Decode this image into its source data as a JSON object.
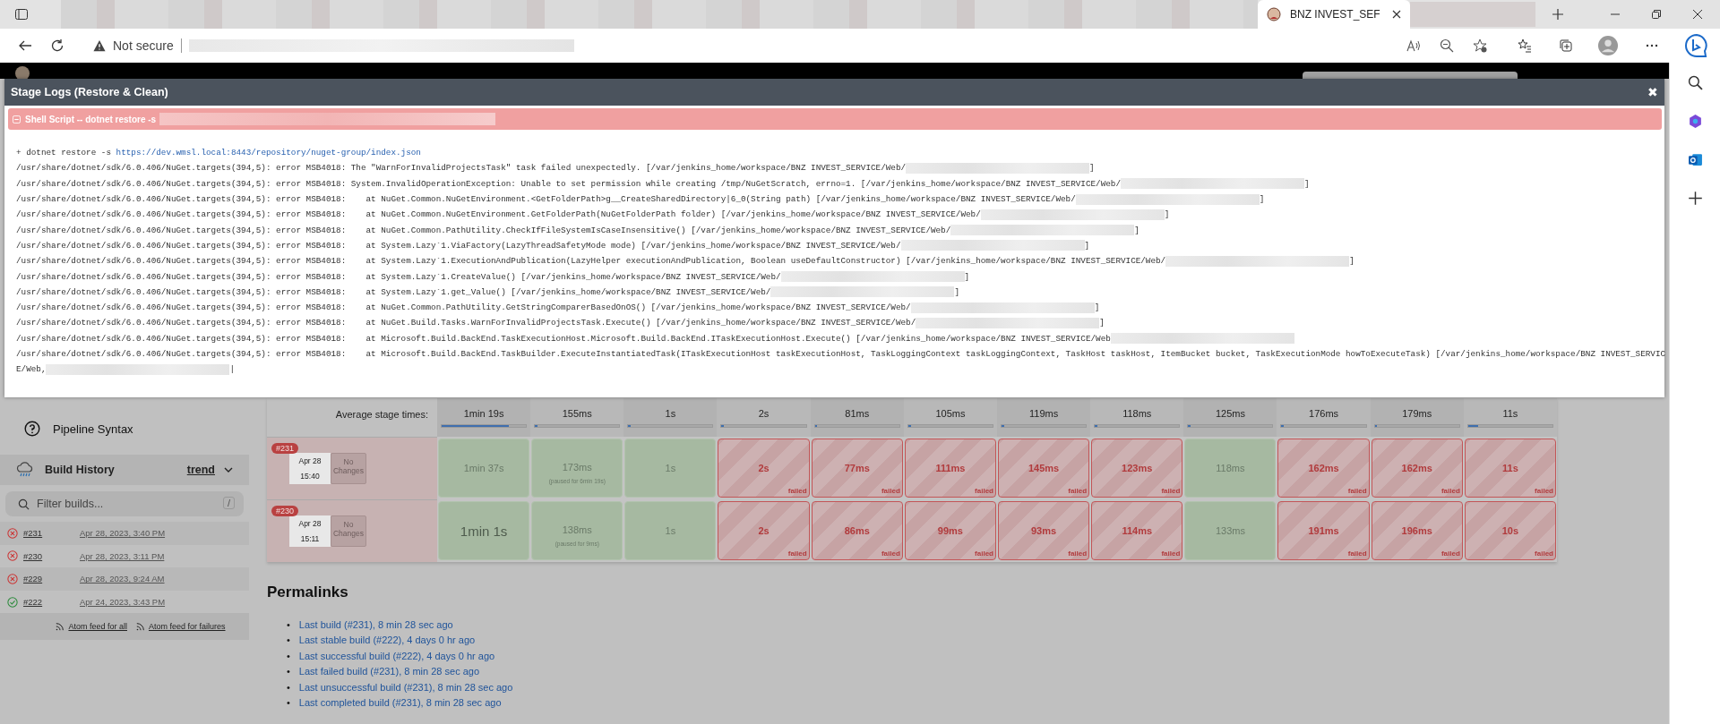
{
  "browser": {
    "tab_title": "BNZ INVEST_SEF",
    "security_label": "Not secure"
  },
  "modal": {
    "title": "Stage Logs (Restore & Clean)",
    "close": "✖",
    "step": {
      "title": "Shell Script -- dotnet restore -s",
      "expanded": true,
      "redacted": true
    },
    "log_lines": [
      {
        "kind": "command",
        "text": "+ dotnet restore -s ",
        "link": "https://dev.wmsl.local:8443/repository/nuget-group/index.json",
        "redacted": false
      },
      {
        "kind": "output",
        "text": "/usr/share/dotnet/sdk/6.0.406/NuGet.targets(394,5): error MSB4018: The \"WarnForInvalidProjectsTask\" task failed unexpectedly. [/var/jenkins_home/workspace/BNZ INVEST_SERVICE/Web/",
        "redacted": true,
        "suffix": "]"
      },
      {
        "kind": "output",
        "text": "/usr/share/dotnet/sdk/6.0.406/NuGet.targets(394,5): error MSB4018: System.InvalidOperationException: Unable to set permission while creating /tmp/NuGetScratch, errno=1. [/var/jenkins_home/workspace/BNZ INVEST_SERVICE/Web/",
        "redacted": true,
        "suffix": "]"
      },
      {
        "kind": "output",
        "text": "/usr/share/dotnet/sdk/6.0.406/NuGet.targets(394,5): error MSB4018:    at NuGet.Common.NuGetEnvironment.<GetFolderPath>g__CreateSharedDirectory|6_0(String path) [/var/jenkins_home/workspace/BNZ INVEST_SERVICE/Web/",
        "redacted": true,
        "suffix": "]"
      },
      {
        "kind": "output",
        "text": "/usr/share/dotnet/sdk/6.0.406/NuGet.targets(394,5): error MSB4018:    at NuGet.Common.NuGetEnvironment.GetFolderPath(NuGetFolderPath folder) [/var/jenkins_home/workspace/BNZ INVEST_SERVICE/Web/",
        "redacted": true,
        "suffix": "]"
      },
      {
        "kind": "output",
        "text": "/usr/share/dotnet/sdk/6.0.406/NuGet.targets(394,5): error MSB4018:    at NuGet.Common.PathUtility.CheckIfFileSystemIsCaseInsensitive() [/var/jenkins_home/workspace/BNZ INVEST_SERVICE/Web/",
        "redacted": true,
        "suffix": "]"
      },
      {
        "kind": "output",
        "text": "/usr/share/dotnet/sdk/6.0.406/NuGet.targets(394,5): error MSB4018:    at System.Lazy`1.ViaFactory(LazyThreadSafetyMode mode) [/var/jenkins_home/workspace/BNZ INVEST_SERVICE/Web/",
        "redacted": true,
        "suffix": "]"
      },
      {
        "kind": "output",
        "text": "/usr/share/dotnet/sdk/6.0.406/NuGet.targets(394,5): error MSB4018:    at System.Lazy`1.ExecutionAndPublication(LazyHelper executionAndPublication, Boolean useDefaultConstructor) [/var/jenkins_home/workspace/BNZ INVEST_SERVICE/Web/",
        "redacted": true,
        "suffix": "]"
      },
      {
        "kind": "output",
        "text": "/usr/share/dotnet/sdk/6.0.406/NuGet.targets(394,5): error MSB4018:    at System.Lazy`1.CreateValue() [/var/jenkins_home/workspace/BNZ INVEST_SERVICE/Web/",
        "redacted": true,
        "suffix": "]"
      },
      {
        "kind": "output",
        "text": "/usr/share/dotnet/sdk/6.0.406/NuGet.targets(394,5): error MSB4018:    at System.Lazy`1.get_Value() [/var/jenkins_home/workspace/BNZ INVEST_SERVICE/Web/",
        "redacted": true,
        "suffix": "]"
      },
      {
        "kind": "output",
        "text": "/usr/share/dotnet/sdk/6.0.406/NuGet.targets(394,5): error MSB4018:    at NuGet.Common.PathUtility.GetStringComparerBasedOnOS() [/var/jenkins_home/workspace/BNZ INVEST_SERVICE/Web/",
        "redacted": true,
        "suffix": "]"
      },
      {
        "kind": "output",
        "text": "/usr/share/dotnet/sdk/6.0.406/NuGet.targets(394,5): error MSB4018:    at NuGet.Build.Tasks.WarnForInvalidProjectsTask.Execute() [/var/jenkins_home/workspace/BNZ INVEST_SERVICE/Web/",
        "redacted": true,
        "suffix": "]"
      },
      {
        "kind": "output",
        "text": "/usr/share/dotnet/sdk/6.0.406/NuGet.targets(394,5): error MSB4018:    at Microsoft.Build.BackEnd.TaskExecutionHost.Microsoft.Build.BackEnd.ITaskExecutionHost.Execute() [/var/jenkins_home/workspace/BNZ INVEST_SERVICE/Web",
        "redacted": true
      },
      {
        "kind": "output",
        "text": "/usr/share/dotnet/sdk/6.0.406/NuGet.targets(394,5): error MSB4018:    at Microsoft.Build.BackEnd.TaskBuilder.ExecuteInstantiatedTask(ITaskExecutionHost taskExecutionHost, TaskLoggingContext taskLoggingContext, TaskHost taskHost, ItemBucket bucket, TaskExecutionMode howToExecuteTask) [/var/jenkins_home/workspace/BNZ INVEST_SERVIC",
        "redacted": false
      },
      {
        "kind": "output",
        "text": "E/Web,",
        "redacted": true,
        "suffix": "|"
      }
    ]
  },
  "sidebar": {
    "items": [
      {
        "label": "Pipeline Syntax"
      }
    ],
    "build_history": {
      "title": "Build History",
      "trend": "trend",
      "filter": {
        "placeholder": "Filter builds...",
        "shortcut": "/"
      },
      "builds": [
        {
          "kind": "failed",
          "number": "#231",
          "date": "Apr 28, 2023, 3:40 PM"
        },
        {
          "kind": "failed",
          "number": "#230",
          "date": "Apr 28, 2023, 3:11 PM"
        },
        {
          "kind": "failed",
          "number": "#229",
          "date": "Apr 28, 2023, 9:24 AM"
        },
        {
          "kind": "success",
          "number": "#222",
          "date": "Apr 24, 2023, 3:43 PM"
        }
      ],
      "feeds": [
        "Atom feed for all",
        "Atom feed for failures"
      ]
    }
  },
  "stage_view": {
    "average_label": "Average stage times:",
    "averages": [
      {
        "time": "1min 19s",
        "level": 0.8
      },
      {
        "time": "155ms",
        "level": 0.03
      },
      {
        "time": "1s",
        "level": 0.03
      },
      {
        "time": "2s",
        "level": 0.03
      },
      {
        "time": "81ms",
        "level": 0.03
      },
      {
        "time": "105ms",
        "level": 0.03
      },
      {
        "time": "119ms",
        "level": 0.03
      },
      {
        "time": "118ms",
        "level": 0.03
      },
      {
        "time": "125ms",
        "level": 0.03
      },
      {
        "time": "176ms",
        "level": 0.03
      },
      {
        "time": "179ms",
        "level": 0.03
      },
      {
        "time": "11s",
        "level": 0.12
      }
    ],
    "builds": [
      {
        "number": "#231",
        "date": "Apr 28",
        "time": "15:40",
        "changes": "No Changes",
        "cells": [
          {
            "time": "1min 37s",
            "kind": "success"
          },
          {
            "time": "173ms",
            "note": "(paused for 6min 19s)",
            "kind": "success"
          },
          {
            "time": "1s",
            "kind": "success"
          },
          {
            "time": "2s",
            "kind": "failed",
            "label": "failed"
          },
          {
            "time": "77ms",
            "kind": "failed",
            "label": "failed"
          },
          {
            "time": "111ms",
            "kind": "failed",
            "label": "failed"
          },
          {
            "time": "145ms",
            "kind": "failed",
            "label": "failed"
          },
          {
            "time": "123ms",
            "kind": "failed",
            "label": "failed"
          },
          {
            "time": "118ms",
            "kind": "success"
          },
          {
            "time": "162ms",
            "kind": "failed",
            "label": "failed"
          },
          {
            "time": "162ms",
            "kind": "failed",
            "label": "failed"
          },
          {
            "time": "11s",
            "kind": "failed",
            "label": "failed"
          }
        ]
      },
      {
        "number": "#230",
        "date": "Apr 28",
        "time": "15:11",
        "changes": "No Changes",
        "cells": [
          {
            "time": "1min 1s",
            "kind": "success"
          },
          {
            "time": "138ms",
            "note": "(paused for 9ms)",
            "kind": "success"
          },
          {
            "time": "1s",
            "kind": "success"
          },
          {
            "time": "2s",
            "kind": "failed",
            "label": "failed"
          },
          {
            "time": "86ms",
            "kind": "failed",
            "label": "failed"
          },
          {
            "time": "99ms",
            "kind": "failed",
            "label": "failed"
          },
          {
            "time": "93ms",
            "kind": "failed",
            "label": "failed"
          },
          {
            "time": "114ms",
            "kind": "failed",
            "label": "failed"
          },
          {
            "time": "133ms",
            "kind": "success"
          },
          {
            "time": "191ms",
            "kind": "failed",
            "label": "failed"
          },
          {
            "time": "196ms",
            "kind": "failed",
            "label": "failed"
          },
          {
            "time": "10s",
            "kind": "failed",
            "label": "failed"
          }
        ]
      }
    ]
  },
  "permalinks": {
    "title": "Permalinks",
    "links": [
      {
        "bullet": "•",
        "text": "Last build (#231), 8 min 28 sec ago"
      },
      {
        "bullet": "•",
        "text": "Last stable build (#222), 4 days 0 hr ago"
      },
      {
        "bullet": "•",
        "text": "Last successful build (#222), 4 days 0 hr ago"
      },
      {
        "bullet": "•",
        "text": "Last failed build (#231), 8 min 28 sec ago"
      },
      {
        "bullet": "•",
        "text": "Last unsuccessful build (#231), 8 min 28 sec ago"
      },
      {
        "bullet": "•",
        "text": "Last completed build (#231), 8 min 28 sec ago"
      }
    ]
  }
}
